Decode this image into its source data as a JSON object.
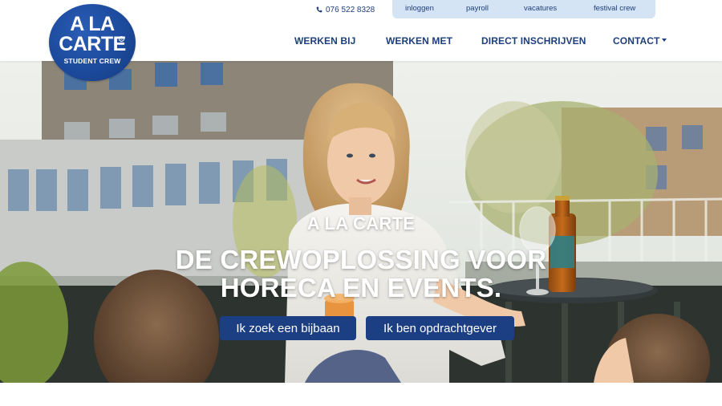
{
  "brand": {
    "logo_line1": "A LA",
    "logo_line2": "CARTE",
    "logo_line3": "STUDENT CREW",
    "primary_color": "#1c4a9c",
    "nav_text_color": "#1d3f7c",
    "topbar_bg": "#d5e4f4"
  },
  "header": {
    "phone": "076 522 8328",
    "phone_icon": "phone-icon",
    "top_links": [
      "inloggen",
      "payroll",
      "vacatures",
      "festival crew"
    ],
    "main_nav": [
      "WERKEN BIJ",
      "WERKEN MET",
      "DIRECT INSCHRIJVEN",
      "CONTACT"
    ],
    "dropdown_icon": "caret-down-icon"
  },
  "hero": {
    "kicker": "A LA CARTE",
    "headline_line1": "DE CREWOPLOSSING VOOR",
    "headline_line2": "HORECA EN EVENTS.",
    "buttons": [
      "Ik zoek een bijbaan",
      "Ik ben opdrachtgever"
    ],
    "button_color": "#1c3f84"
  }
}
